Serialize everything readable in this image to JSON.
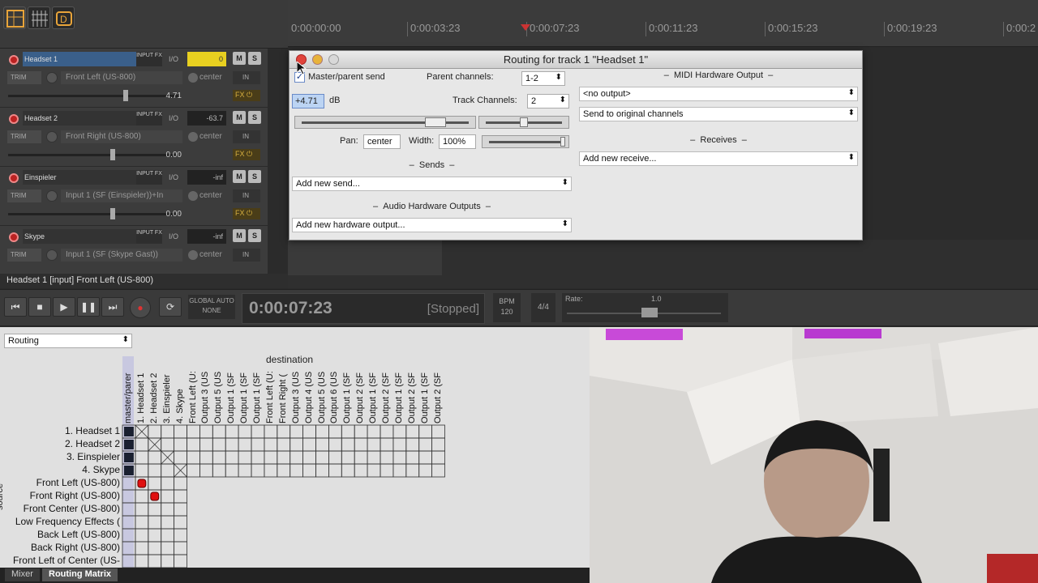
{
  "timeline": {
    "labels": [
      "0:00:00:00",
      "0:00:03:23",
      "0:00:07:23",
      "0:00:11:23",
      "0:00:15:23",
      "0:00:19:23",
      "0:00:2"
    ]
  },
  "tracks": [
    {
      "name": "Headset 1",
      "fx": "INPUT FX",
      "io": "I/O",
      "vol": "0",
      "m": "M",
      "s": "S",
      "trim": "TRIM",
      "input": "Front Left (US-800)",
      "pan": "center",
      "in": "IN",
      "db": "4.71",
      "fxbtn": "FX ⏻",
      "selected": true
    },
    {
      "name": "Headset 2",
      "fx": "INPUT FX",
      "io": "I/O",
      "vol": "-63.7",
      "m": "M",
      "s": "S",
      "trim": "TRIM",
      "input": "Front Right (US-800)",
      "pan": "center",
      "in": "IN",
      "db": "0.00",
      "fxbtn": "FX ⏻",
      "selected": false
    },
    {
      "name": "Einspieler",
      "fx": "INPUT FX",
      "io": "I/O",
      "vol": "-inf",
      "m": "M",
      "s": "S",
      "trim": "TRIM",
      "input": "Input 1 (SF (Einspieler))+In",
      "pan": "center",
      "in": "IN",
      "db": "0.00",
      "fxbtn": "FX ⏻",
      "selected": false
    },
    {
      "name": "Skype",
      "fx": "INPUT FX",
      "io": "I/O",
      "vol": "-inf",
      "m": "M",
      "s": "S",
      "trim": "TRIM",
      "input": "Input 1 (SF (Skype Gast))",
      "pan": "center",
      "in": "IN",
      "db": "0.00",
      "fxbtn": "FX ⏻",
      "selected": false
    }
  ],
  "status_line": "Headset 1 [input] Front Left (US-800)",
  "transport": {
    "global_auto_label": "GLOBAL AUTO",
    "global_auto_value": "NONE",
    "time": "0:00:07:23",
    "state": "[Stopped]",
    "bpm_label": "BPM",
    "bpm_value": "120",
    "time_sig": "4/4",
    "rate_label": "Rate:",
    "rate_value": "1.0"
  },
  "routing_window": {
    "title": "Routing for track 1 \"Headset 1\"",
    "master_send_label": "Master/parent send",
    "master_send_checked": true,
    "parent_channels_label": "Parent channels:",
    "parent_channels_value": "1-2",
    "db_value": "+4.71",
    "db_unit": "dB",
    "track_channels_label": "Track Channels:",
    "track_channels_value": "2",
    "pan_label": "Pan:",
    "pan_value": "center",
    "width_label": "Width:",
    "width_value": "100%",
    "sends_section": "Sends",
    "add_send": "Add new send...",
    "hw_outputs_section": "Audio Hardware Outputs",
    "add_hw_output": "Add new hardware output...",
    "midi_section": "MIDI Hardware Output",
    "midi_output": "<no output>",
    "midi_channels": "Send to original channels",
    "receives_section": "Receives",
    "add_receive": "Add new receive..."
  },
  "matrix": {
    "mode": "Routing",
    "destination_label": "destination",
    "source_label": "source",
    "columns": [
      "master/parer",
      "1. Headset 1",
      "2. Headset 2",
      "3. Einspieler",
      "4. Skype",
      "Front Left (U:",
      "Output 3 (US",
      "Output 5 (US",
      "Output 1 (SF",
      "Output 1 (SF",
      "Output 1 (SF",
      "Front Left (U:",
      "Front Right (",
      "Output 3 (US",
      "Output 4 (US",
      "Output 5 (US",
      "Output 6 (US",
      "Output 1 (SF",
      "Output 2 (SF",
      "Output 1 (SF",
      "Output 2 (SF",
      "Output 1 (SF",
      "Output 2 (SF",
      "Output 1 (SF",
      "Output 2 (SF"
    ],
    "rows": [
      "1. Headset 1",
      "2. Headset 2",
      "3. Einspieler",
      "4. Skype",
      "Front Left (US-800)",
      "Front Right (US-800)",
      "Front Center (US-800)",
      "Low Frequency Effects (",
      "Back Left (US-800)",
      "Back Right (US-800)",
      "Front Left of Center (US-"
    ]
  },
  "tabs": [
    {
      "label": "Mixer",
      "active": false
    },
    {
      "label": "Routing Matrix",
      "active": true
    }
  ],
  "colors": {
    "accent_select": "#3a5f8a",
    "record": "#cc2222",
    "meter": "#e8d020",
    "matrix_bg": "#e0e0e0"
  }
}
